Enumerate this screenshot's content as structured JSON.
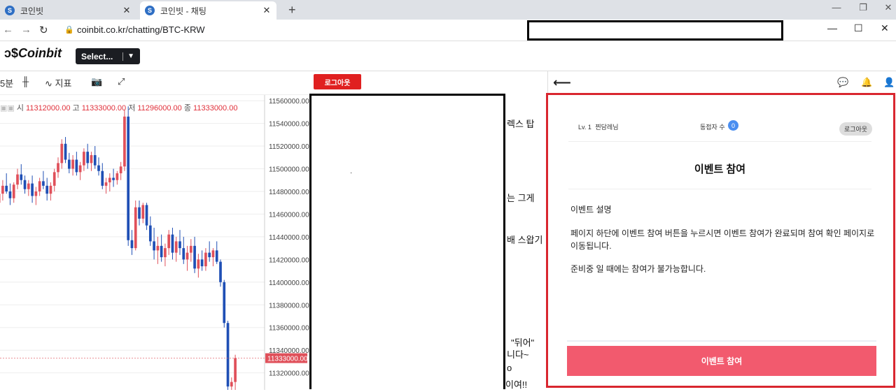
{
  "browser": {
    "tabs": [
      {
        "title": "코인빗",
        "icon": "coinbit-favicon"
      },
      {
        "title": "코인빗 - 채팅",
        "icon": "coinbit-favicon"
      }
    ],
    "new_tab": "+",
    "url": "coinbit.co.kr/chatting/BTC-KRW"
  },
  "header": {
    "logo": "Coinbit",
    "select_label": "Select..."
  },
  "toolbar": {
    "interval": "5분",
    "indicator": "지표",
    "logout": "로그아웃"
  },
  "ohlc": {
    "open_label": "시",
    "open": "11312000.00",
    "high_label": "고",
    "high": "11333000.00",
    "low_label": "저",
    "low": "11296000.00",
    "close_label": "종",
    "close": "11333000.00"
  },
  "chart_data": {
    "type": "candlestick",
    "price_axis": [
      "11560000.00",
      "11540000.00",
      "11520000.00",
      "11500000.00",
      "11480000.00",
      "11460000.00",
      "11440000.00",
      "11420000.00",
      "11400000.00",
      "11380000.00",
      "11360000.00",
      "11340000.00",
      "11320000.00"
    ],
    "current_price": "11333000.00",
    "ylim": [
      11305000,
      11565000
    ],
    "up_color": "#e0505a",
    "down_color": "#1f4fb5",
    "candles": [
      [
        11470000,
        11482000,
        11465000,
        11478000
      ],
      [
        11478000,
        11490000,
        11472000,
        11485000
      ],
      [
        11485000,
        11496000,
        11478000,
        11480000
      ],
      [
        11480000,
        11487000,
        11468000,
        11474000
      ],
      [
        11474000,
        11488000,
        11470000,
        11486000
      ],
      [
        11486000,
        11500000,
        11482000,
        11495000
      ],
      [
        11495000,
        11504000,
        11486000,
        11490000
      ],
      [
        11490000,
        11494000,
        11478000,
        11482000
      ],
      [
        11482000,
        11490000,
        11476000,
        11487000
      ],
      [
        11487000,
        11494000,
        11470000,
        11476000
      ],
      [
        11476000,
        11484000,
        11468000,
        11480000
      ],
      [
        11480000,
        11492000,
        11476000,
        11489000
      ],
      [
        11489000,
        11498000,
        11482000,
        11485000
      ],
      [
        11485000,
        11492000,
        11472000,
        11478000
      ],
      [
        11478000,
        11488000,
        11472000,
        11485000
      ],
      [
        11485000,
        11500000,
        11480000,
        11497000
      ],
      [
        11497000,
        11510000,
        11492000,
        11505000
      ],
      [
        11505000,
        11526000,
        11500000,
        11522000
      ],
      [
        11522000,
        11528000,
        11505000,
        11508000
      ],
      [
        11508000,
        11514000,
        11496000,
        11500000
      ],
      [
        11500000,
        11512000,
        11494000,
        11508000
      ],
      [
        11508000,
        11515000,
        11494000,
        11497000
      ],
      [
        11497000,
        11506000,
        11490000,
        11503000
      ],
      [
        11503000,
        11518000,
        11498000,
        11515000
      ],
      [
        11515000,
        11522000,
        11500000,
        11505000
      ],
      [
        11505000,
        11515000,
        11498000,
        11512000
      ],
      [
        11512000,
        11520000,
        11500000,
        11503000
      ],
      [
        11503000,
        11510000,
        11494000,
        11498000
      ],
      [
        11498000,
        11505000,
        11482000,
        11485000
      ],
      [
        11485000,
        11492000,
        11478000,
        11488000
      ],
      [
        11488000,
        11496000,
        11480000,
        11492000
      ],
      [
        11492000,
        11500000,
        11484000,
        11490000
      ],
      [
        11490000,
        11498000,
        11486000,
        11496000
      ],
      [
        11496000,
        11506000,
        11490000,
        11502000
      ],
      [
        11502000,
        11552000,
        11498000,
        11546000
      ],
      [
        11546000,
        11555000,
        11432000,
        11437000
      ],
      [
        11437000,
        11446000,
        11424000,
        11430000
      ],
      [
        11430000,
        11472000,
        11428000,
        11466000
      ],
      [
        11466000,
        11472000,
        11450000,
        11456000
      ],
      [
        11456000,
        11470000,
        11452000,
        11468000
      ],
      [
        11468000,
        11470000,
        11446000,
        11450000
      ],
      [
        11450000,
        11458000,
        11432000,
        11436000
      ],
      [
        11436000,
        11448000,
        11420000,
        11428000
      ],
      [
        11428000,
        11440000,
        11416000,
        11432000
      ],
      [
        11432000,
        11442000,
        11418000,
        11422000
      ],
      [
        11422000,
        11434000,
        11414000,
        11430000
      ],
      [
        11430000,
        11446000,
        11424000,
        11442000
      ],
      [
        11442000,
        11448000,
        11420000,
        11426000
      ],
      [
        11426000,
        11440000,
        11418000,
        11436000
      ],
      [
        11436000,
        11446000,
        11424000,
        11430000
      ],
      [
        11430000,
        11440000,
        11416000,
        11420000
      ],
      [
        11420000,
        11432000,
        11410000,
        11426000
      ],
      [
        11426000,
        11438000,
        11418000,
        11432000
      ],
      [
        11432000,
        11440000,
        11408000,
        11412000
      ],
      [
        11412000,
        11425000,
        11404000,
        11420000
      ],
      [
        11420000,
        11428000,
        11410000,
        11414000
      ],
      [
        11414000,
        11430000,
        11410000,
        11426000
      ],
      [
        11426000,
        11436000,
        11418000,
        11422000
      ],
      [
        11422000,
        11430000,
        11414000,
        11428000
      ],
      [
        11428000,
        11436000,
        11416000,
        11418000
      ],
      [
        11418000,
        11420000,
        11396000,
        11400000
      ],
      [
        11400000,
        11402000,
        11360000,
        11364000
      ],
      [
        11364000,
        11366000,
        11304000,
        11308000
      ],
      [
        11308000,
        11316000,
        11300000,
        11312000
      ],
      [
        11312000,
        11336000,
        11298000,
        11333000
      ]
    ]
  },
  "chat_fragments": [
    "렉스 탑",
    "는 그게",
    "배 스왑기",
    "\"뒤어\"",
    "니다~",
    "o",
    "이여!!"
  ],
  "panel": {
    "level": "Lv. 1",
    "nickname": "찐담레님",
    "users_label": "동접자 수",
    "users_count": "0",
    "logout": "로그아웃",
    "title": "이벤트 참여",
    "desc_heading": "이벤트 설명",
    "desc_line1": "페이지 하단에 이벤트 참여 버튼을 누르시면 이벤트 참여가 완료되며 참여 확인 페이지로",
    "desc_line2": "이동됩니다.",
    "desc_line3": "준비중 일 때에는 참여가 불가능합니다.",
    "button": "이벤트 참여"
  }
}
